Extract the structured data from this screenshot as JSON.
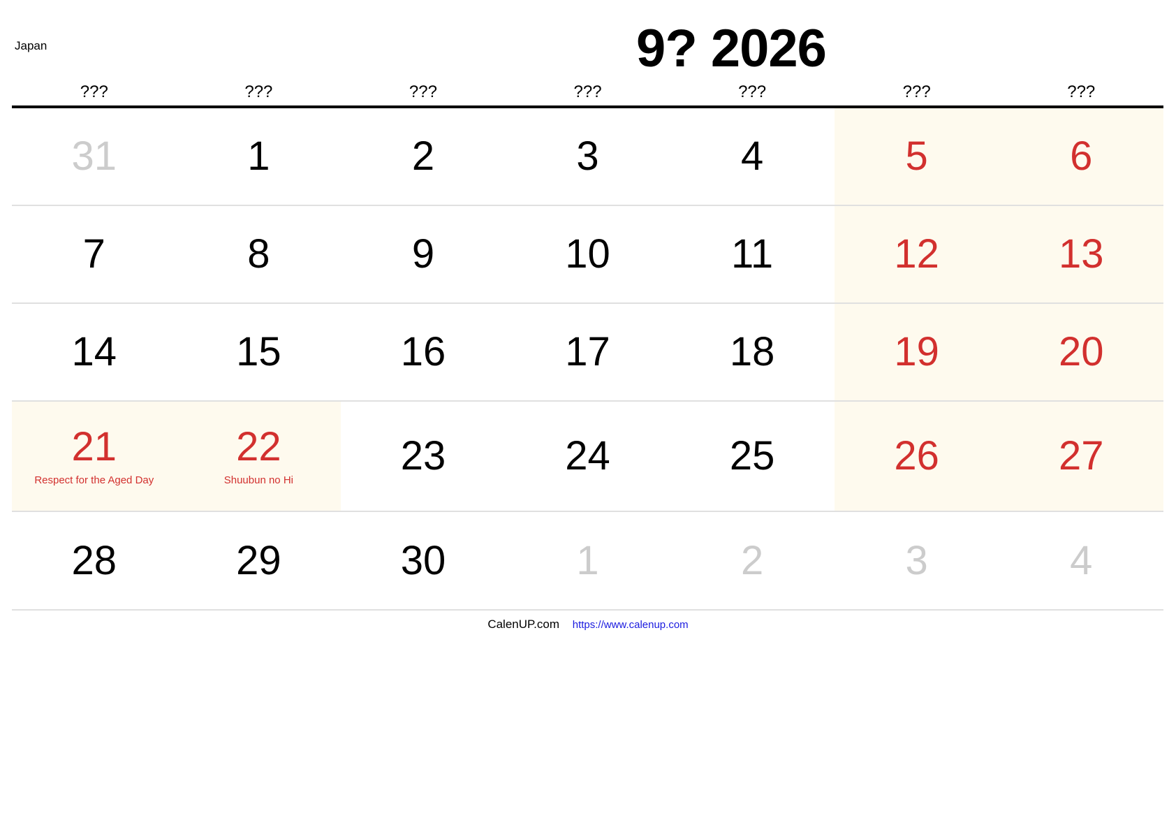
{
  "country": "Japan",
  "title": "9? 2026",
  "weekdays": [
    "???",
    "???",
    "???",
    "???",
    "???",
    "???",
    "???"
  ],
  "weeks": [
    [
      {
        "day": "31",
        "type": "other"
      },
      {
        "day": "1",
        "type": "normal"
      },
      {
        "day": "2",
        "type": "normal"
      },
      {
        "day": "3",
        "type": "normal"
      },
      {
        "day": "4",
        "type": "normal"
      },
      {
        "day": "5",
        "type": "weekend"
      },
      {
        "day": "6",
        "type": "weekend"
      }
    ],
    [
      {
        "day": "7",
        "type": "normal"
      },
      {
        "day": "8",
        "type": "normal"
      },
      {
        "day": "9",
        "type": "normal"
      },
      {
        "day": "10",
        "type": "normal"
      },
      {
        "day": "11",
        "type": "normal"
      },
      {
        "day": "12",
        "type": "weekend"
      },
      {
        "day": "13",
        "type": "weekend"
      }
    ],
    [
      {
        "day": "14",
        "type": "normal"
      },
      {
        "day": "15",
        "type": "normal"
      },
      {
        "day": "16",
        "type": "normal"
      },
      {
        "day": "17",
        "type": "normal"
      },
      {
        "day": "18",
        "type": "normal"
      },
      {
        "day": "19",
        "type": "weekend"
      },
      {
        "day": "20",
        "type": "weekend"
      }
    ],
    [
      {
        "day": "21",
        "type": "holiday",
        "holiday": "Respect for the Aged Day"
      },
      {
        "day": "22",
        "type": "holiday",
        "holiday": "Shuubun no Hi"
      },
      {
        "day": "23",
        "type": "normal"
      },
      {
        "day": "24",
        "type": "normal"
      },
      {
        "day": "25",
        "type": "normal"
      },
      {
        "day": "26",
        "type": "weekend"
      },
      {
        "day": "27",
        "type": "weekend"
      }
    ],
    [
      {
        "day": "28",
        "type": "normal"
      },
      {
        "day": "29",
        "type": "normal"
      },
      {
        "day": "30",
        "type": "normal"
      },
      {
        "day": "1",
        "type": "other"
      },
      {
        "day": "2",
        "type": "other"
      },
      {
        "day": "3",
        "type": "other"
      },
      {
        "day": "4",
        "type": "other"
      }
    ]
  ],
  "footer": {
    "site": "CalenUP.com",
    "url": "https://www.calenup.com"
  },
  "colors": {
    "holiday_text": "#d2302e",
    "weekend_bg": "#fefaee",
    "other_month_text": "#cccccc",
    "link": "#1a1adf"
  }
}
